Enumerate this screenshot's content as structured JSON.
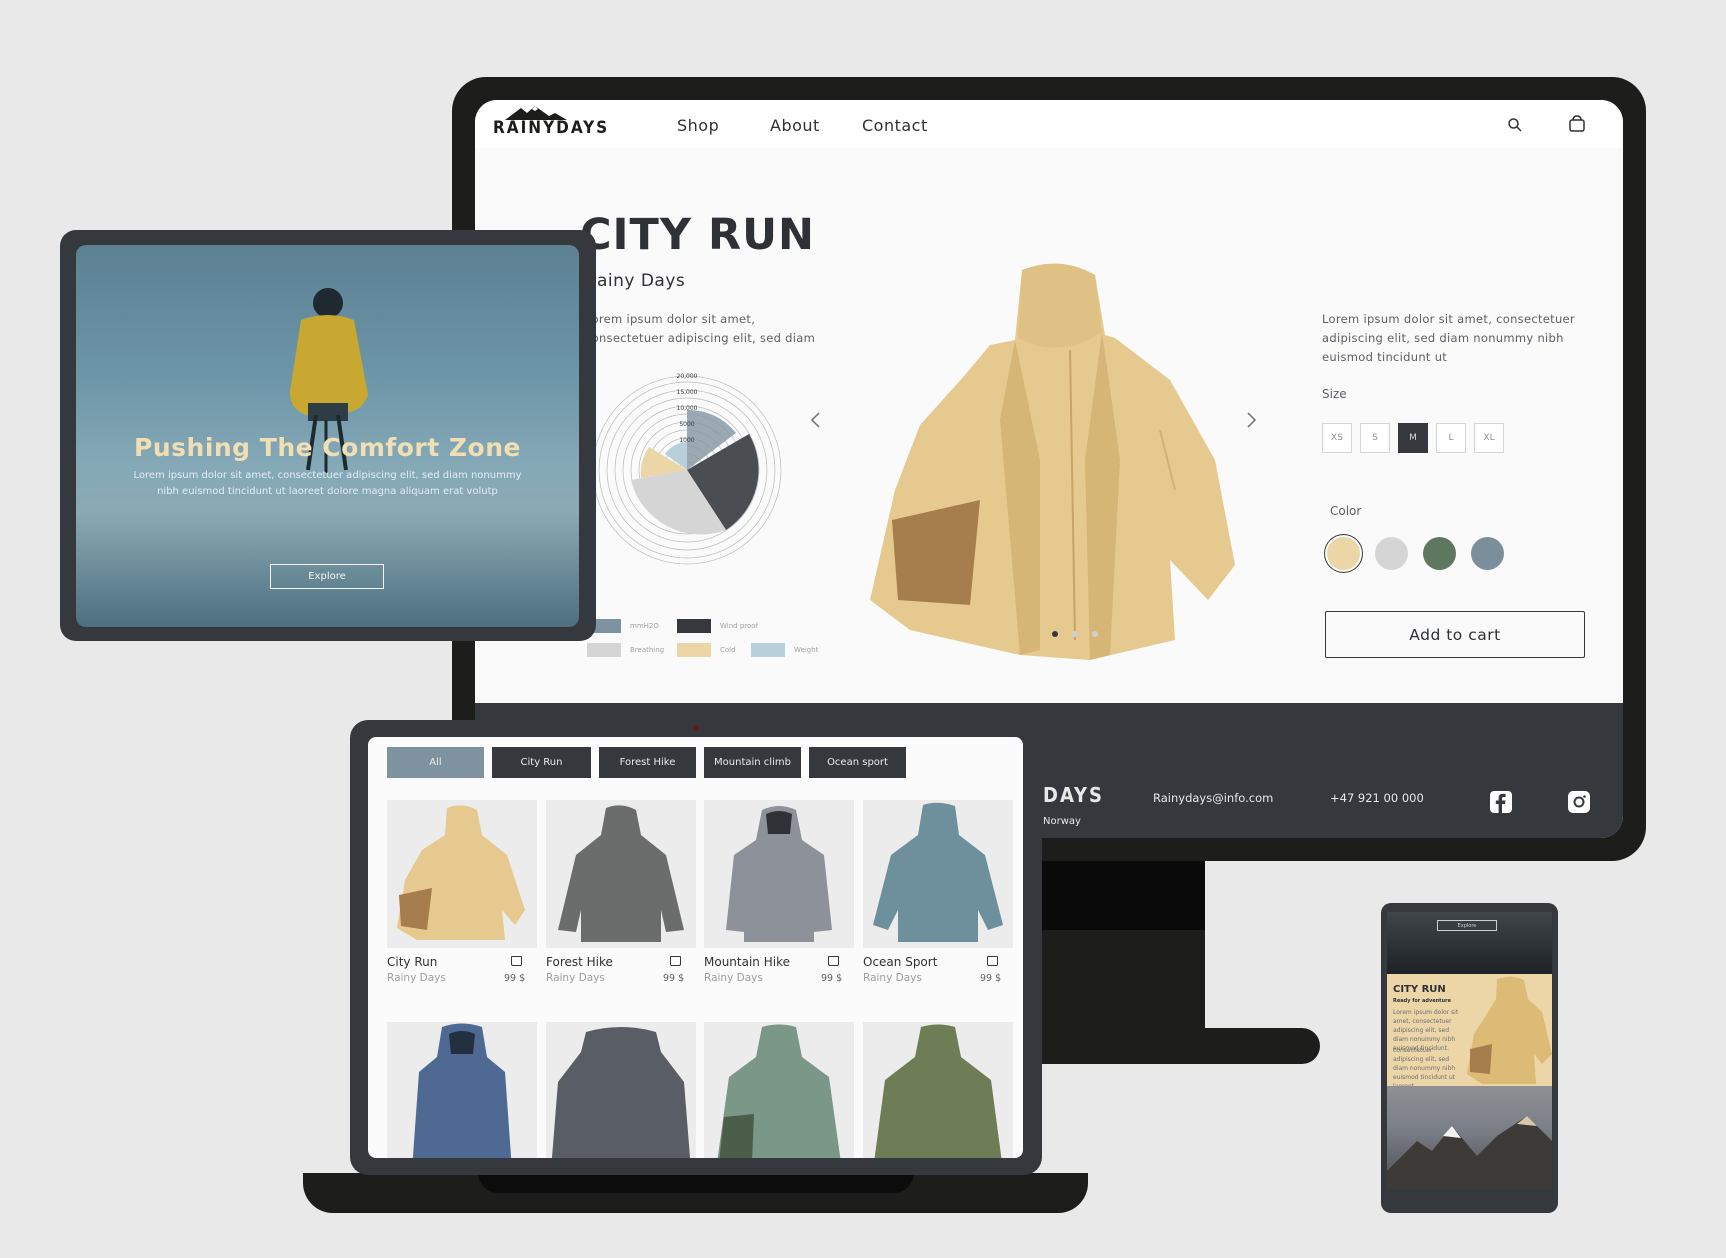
{
  "desktop": {
    "logo": "RAINYDAYS",
    "nav": {
      "shop": "Shop",
      "about": "About",
      "contact": "Contact"
    },
    "product_title": "CITY RUN",
    "brand": "Rainy Days",
    "left_description": "Lorem ipsum dolor sit amet, consectetuer adipiscing elit, sed diam",
    "right_description": "Lorem ipsum dolor sit amet, consectetuer adipiscing elit, sed diam nonummy nibh euismod tincidunt ut",
    "size_label": "Size",
    "sizes": [
      "XS",
      "S",
      "M",
      "L",
      "XL"
    ],
    "selected_size": "M",
    "color_label": "Color",
    "colors": [
      "#ecd5a6",
      "#d5d5d5",
      "#5e7761",
      "#7b8e9a"
    ],
    "add_to_cart": "Add to cart",
    "chart_ticks": [
      "20,000",
      "15,000",
      "10,000",
      "5000",
      "1000"
    ],
    "legend": [
      "mmH2O",
      "Wind proof",
      "Breathing",
      "Cold",
      "Weight"
    ],
    "legend_colors": [
      "#7f929f",
      "#35393e",
      "#d5d5d5",
      "#ecd5a6",
      "#b9cfdb"
    ],
    "footer": {
      "logo_part": "DAYS",
      "email": "Rainydays@info.com",
      "phone": "+47 921 00 000",
      "country": "Norway"
    }
  },
  "tablet": {
    "hero_title": "Pushing The Comfort Zone",
    "hero_text_line1": "Lorem ipsum dolor sit amet, consectetuer adipiscing elit, sed diam nonummy",
    "hero_text_line2": "nibh euismod tincidunt ut laoreet dolore magna aliquam erat volutp",
    "explore": "Explore"
  },
  "laptop": {
    "filters": [
      "All",
      "City Run",
      "Forest Hike",
      "Mountain climb",
      "Ocean sport"
    ],
    "products": [
      {
        "name": "City Run",
        "brand": "Rainy Days",
        "price": "99 $",
        "color": "#e5c98f"
      },
      {
        "name": "Forest Hike",
        "brand": "Rainy Days",
        "price": "99 $",
        "color": "#6b6c6c"
      },
      {
        "name": "Mountain Hike",
        "brand": "Rainy Days",
        "price": "99 $",
        "color": "#8d9199"
      },
      {
        "name": "Ocean Sport",
        "brand": "Rainy Days",
        "price": "99 $",
        "color": "#6e8f9c"
      }
    ],
    "row2_colors": [
      "#4e6a92",
      "#595d66",
      "#7b9787",
      "#6e7d56"
    ]
  },
  "phone": {
    "header_button": "Explore",
    "title": "CITY RUN",
    "subtitle": "Ready for adventure",
    "text1": "Lorem ipsum dolor sit amet, consectetuer adipiscing elit, sed diam nonummy nibh euismod tincidunt.",
    "text2": "consectetuer adipiscing elit, sed diam nonummy nibh euismod tincidunt ut laoreet"
  }
}
